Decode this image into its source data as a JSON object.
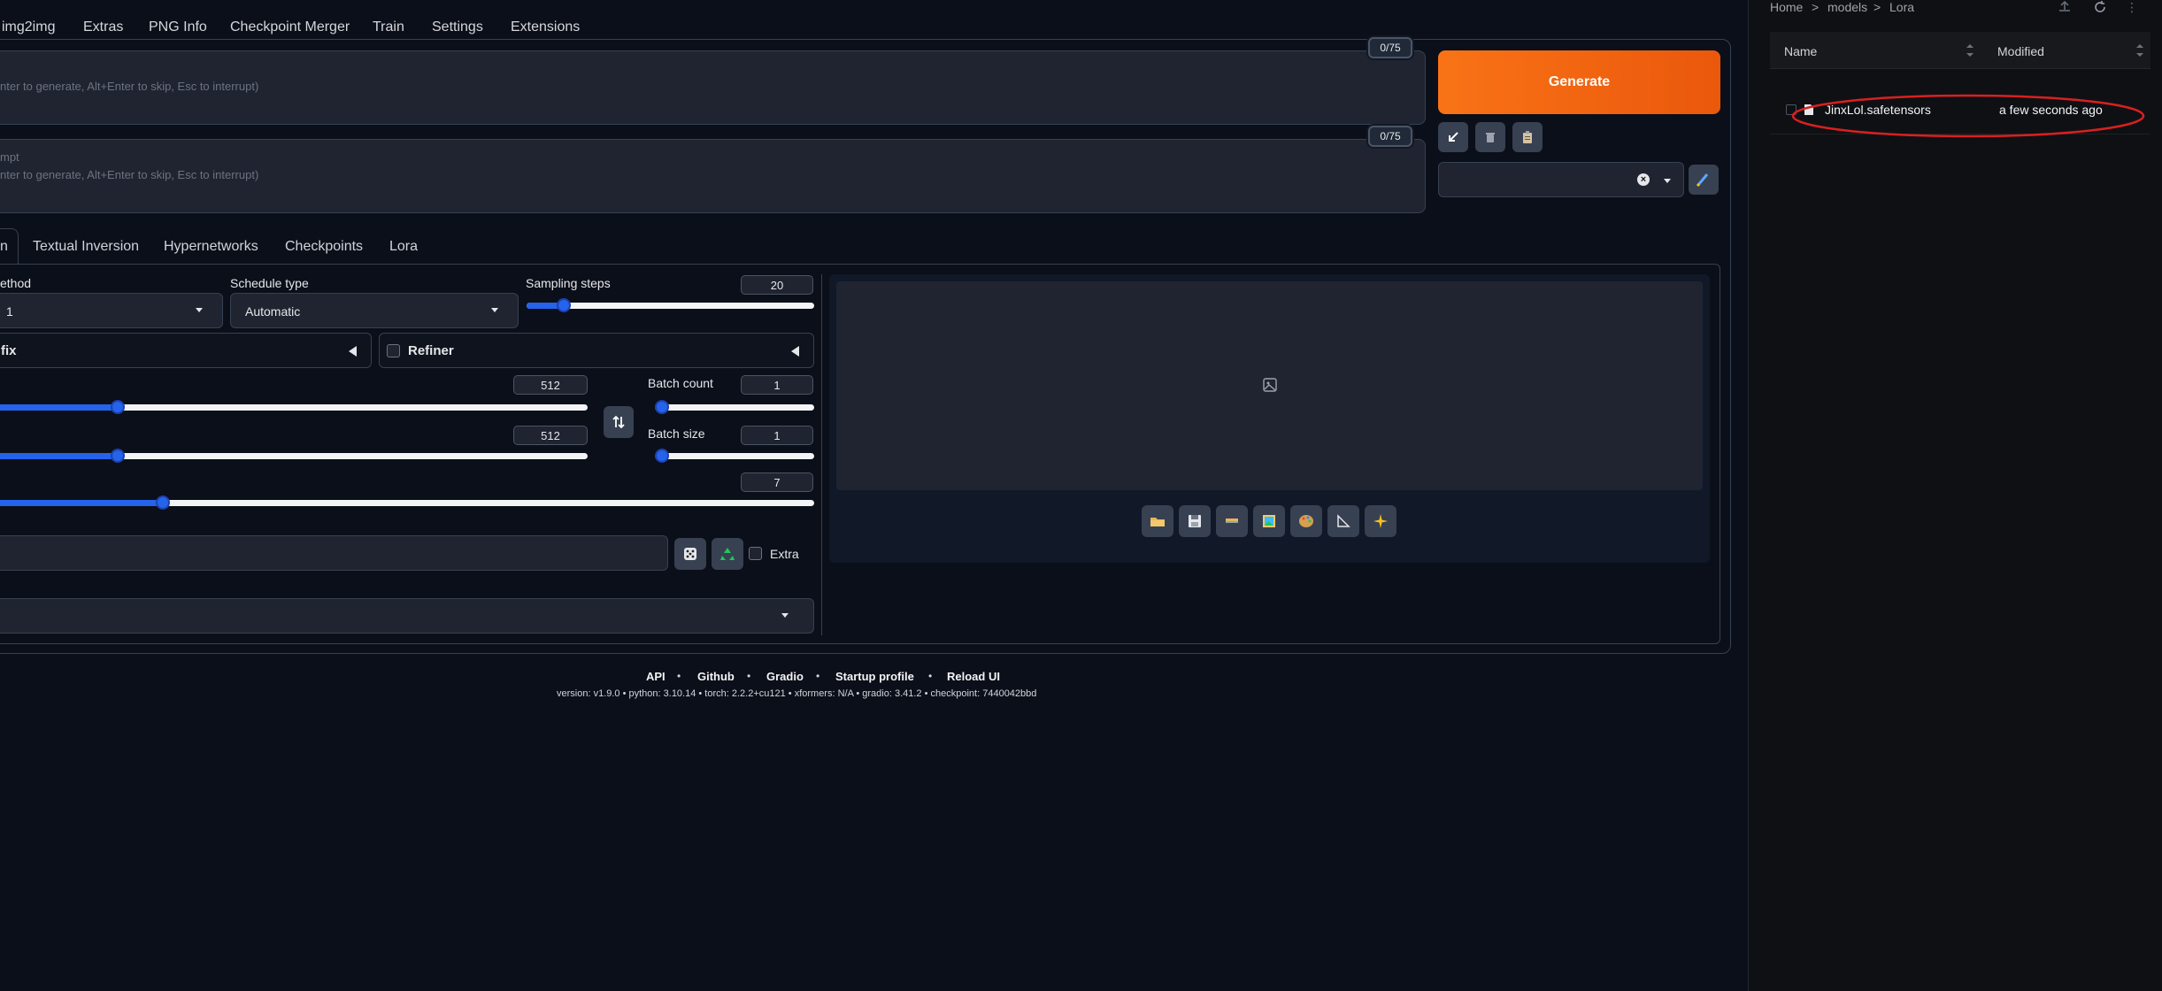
{
  "nav": {
    "tabs": [
      "img2img",
      "Extras",
      "PNG Info",
      "Checkpoint Merger",
      "Train",
      "Settings",
      "Extensions"
    ]
  },
  "prompt": {
    "placeholder": "nter to generate, Alt+Enter to skip, Esc to interrupt)",
    "counter": "0/75"
  },
  "negative_prompt": {
    "placeholder_line1": "mpt",
    "placeholder_line2": "nter to generate, Alt+Enter to skip, Esc to interrupt)",
    "counter": "0/75"
  },
  "generate_label": "Generate",
  "action_icons": {
    "read_params": "arrow-down-left-icon",
    "trash": "trash-icon",
    "paste": "clipboard-icon",
    "clear": "x-circle-icon",
    "edit_styles": "pencil-icon"
  },
  "subtabs": [
    "n",
    "Textual Inversion",
    "Hypernetworks",
    "Checkpoints",
    "Lora"
  ],
  "sampling": {
    "method_label": "ethod",
    "method_value": "1",
    "schedule_label": "Schedule type",
    "schedule_value": "Automatic",
    "steps_label": "Sampling steps",
    "steps_value": "20",
    "steps_fraction": 0.13
  },
  "hires": {
    "label": "fix"
  },
  "refiner": {
    "label": "Refiner"
  },
  "width": {
    "value": "512",
    "fraction": 0.2
  },
  "height": {
    "value": "512",
    "fraction": 0.2
  },
  "batch_count": {
    "label": "Batch count",
    "value": "1",
    "fraction": 0.0
  },
  "batch_size": {
    "label": "Batch size",
    "value": "1",
    "fraction": 0.0
  },
  "cfg": {
    "value": "7",
    "fraction": 0.2
  },
  "seed": {
    "extra_label": "Extra"
  },
  "output_tools": [
    "folder-icon",
    "save-icon",
    "zip-icon",
    "image-icon",
    "palette-icon",
    "ruler-icon",
    "sparkles-icon"
  ],
  "footer": {
    "links": [
      "API",
      "Github",
      "Gradio",
      "Startup profile",
      "Reload UI"
    ],
    "info": "version: v1.9.0  •  python: 3.10.14  •  torch: 2.2.2+cu121  •  xformers: N/A  •  gradio: 3.41.2  •  checkpoint: 7440042bbd",
    "info_parts": {
      "version": "v1.9.0",
      "python": "3.10.14",
      "torch": "2.2.2+cu121",
      "xformers": "N/A",
      "gradio": "3.41.2",
      "checkpoint": "7440042bbd"
    }
  },
  "file_browser": {
    "breadcrumb": [
      "Home",
      "models",
      "Lora"
    ],
    "separator": ">",
    "columns": [
      "Name",
      "Modified"
    ],
    "files": [
      {
        "name": "JinxLol.safetensors",
        "modified": "a few seconds ago"
      }
    ],
    "annotation_color": "#d92020"
  },
  "colors": {
    "background": "#0b0f19",
    "accent": "#f97316",
    "slider": "#2563eb"
  }
}
